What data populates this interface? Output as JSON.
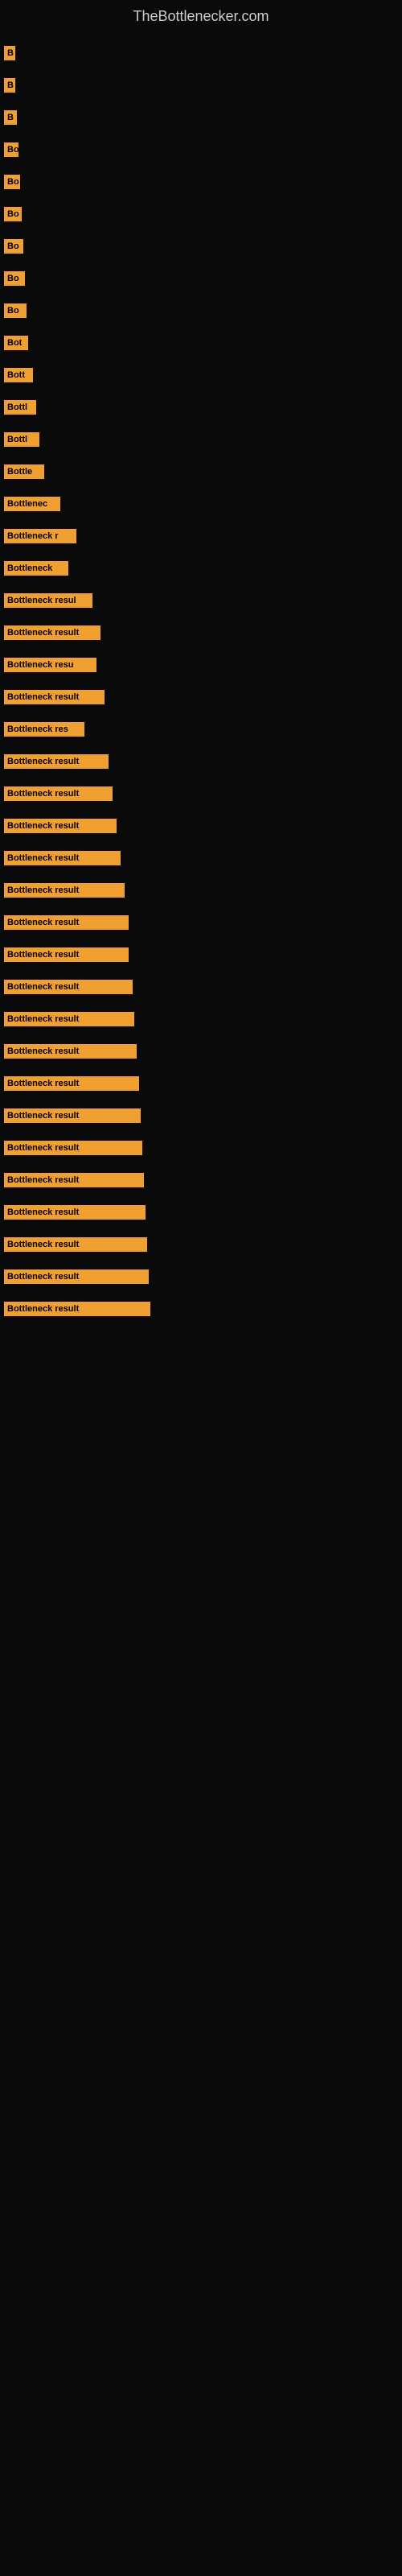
{
  "site": {
    "title": "TheBottlenecker.com"
  },
  "bars": [
    {
      "id": 1,
      "label": "B",
      "width": 14
    },
    {
      "id": 2,
      "label": "B",
      "width": 14
    },
    {
      "id": 3,
      "label": "B",
      "width": 16
    },
    {
      "id": 4,
      "label": "Bo",
      "width": 18
    },
    {
      "id": 5,
      "label": "Bo",
      "width": 20
    },
    {
      "id": 6,
      "label": "Bo",
      "width": 22
    },
    {
      "id": 7,
      "label": "Bo",
      "width": 24
    },
    {
      "id": 8,
      "label": "Bo",
      "width": 26
    },
    {
      "id": 9,
      "label": "Bo",
      "width": 28
    },
    {
      "id": 10,
      "label": "Bot",
      "width": 30
    },
    {
      "id": 11,
      "label": "Bott",
      "width": 36
    },
    {
      "id": 12,
      "label": "Bottl",
      "width": 40
    },
    {
      "id": 13,
      "label": "Bottl",
      "width": 44
    },
    {
      "id": 14,
      "label": "Bottle",
      "width": 50
    },
    {
      "id": 15,
      "label": "Bottlenec",
      "width": 70
    },
    {
      "id": 16,
      "label": "Bottleneck r",
      "width": 90
    },
    {
      "id": 17,
      "label": "Bottleneck ",
      "width": 80
    },
    {
      "id": 18,
      "label": "Bottleneck resul",
      "width": 110
    },
    {
      "id": 19,
      "label": "Bottleneck result",
      "width": 120
    },
    {
      "id": 20,
      "label": "Bottleneck resu",
      "width": 115
    },
    {
      "id": 21,
      "label": "Bottleneck result",
      "width": 125
    },
    {
      "id": 22,
      "label": "Bottleneck res",
      "width": 100
    },
    {
      "id": 23,
      "label": "Bottleneck result",
      "width": 130
    },
    {
      "id": 24,
      "label": "Bottleneck result",
      "width": 135
    },
    {
      "id": 25,
      "label": "Bottleneck result",
      "width": 140
    },
    {
      "id": 26,
      "label": "Bottleneck result",
      "width": 145
    },
    {
      "id": 27,
      "label": "Bottleneck result",
      "width": 150
    },
    {
      "id": 28,
      "label": "Bottleneck result",
      "width": 155
    },
    {
      "id": 29,
      "label": "Bottleneck result",
      "width": 155
    },
    {
      "id": 30,
      "label": "Bottleneck result",
      "width": 160
    },
    {
      "id": 31,
      "label": "Bottleneck result",
      "width": 162
    },
    {
      "id": 32,
      "label": "Bottleneck result",
      "width": 165
    },
    {
      "id": 33,
      "label": "Bottleneck result",
      "width": 168
    },
    {
      "id": 34,
      "label": "Bottleneck result",
      "width": 170
    },
    {
      "id": 35,
      "label": "Bottleneck result",
      "width": 172
    },
    {
      "id": 36,
      "label": "Bottleneck result",
      "width": 174
    },
    {
      "id": 37,
      "label": "Bottleneck result",
      "width": 176
    },
    {
      "id": 38,
      "label": "Bottleneck result",
      "width": 178
    },
    {
      "id": 39,
      "label": "Bottleneck result",
      "width": 180
    },
    {
      "id": 40,
      "label": "Bottleneck result",
      "width": 182
    }
  ]
}
